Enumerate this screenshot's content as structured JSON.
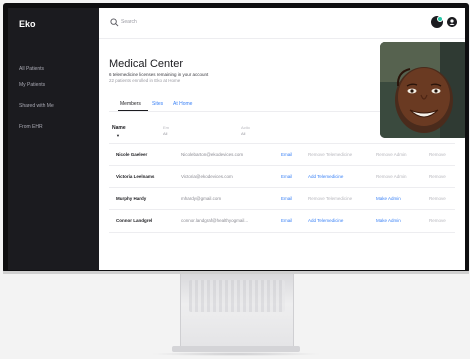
{
  "app": {
    "logo": "Eko"
  },
  "sidebar": {
    "items": [
      {
        "label": "All Patients"
      },
      {
        "label": "My Patients"
      },
      {
        "label": "Shared with Me"
      },
      {
        "label": "From EHR"
      }
    ]
  },
  "search": {
    "placeholder": "Search"
  },
  "page": {
    "title": "Medical Center",
    "subtitle": "6 telemedicine licenses remaining in your account",
    "note": "22 patients enrolled in Eko at Home"
  },
  "tabs": [
    {
      "label": "Members",
      "active": true
    },
    {
      "label": "Sites",
      "active": false
    },
    {
      "label": "At Home",
      "active": false
    }
  ],
  "table": {
    "headers": {
      "name": "Name",
      "name_sort": "▼",
      "col2": "Em",
      "col2_sub": "All",
      "col3": "Actio",
      "col3_sub": "All"
    },
    "rows": [
      {
        "name": "Nicole Gaeleer",
        "email": "Nicolebarton@ekodevices.com",
        "a1": "Email",
        "a2": "Remove Telemedicine",
        "a2_link": false,
        "a3": "Remove Admin",
        "a3_link": false,
        "a4": "Remove"
      },
      {
        "name": "Victoria Leelnams",
        "email": "Victoria@ekodevices.com",
        "a1": "Email",
        "a2": "Add Telemedicine",
        "a2_link": true,
        "a3": "Remove Admin",
        "a3_link": false,
        "a4": "Remove"
      },
      {
        "name": "Murphy Hardy",
        "email": "mhardy@gmail.com",
        "a1": "Email",
        "a2": "Remove Telemedicine",
        "a2_link": false,
        "a3": "Make Admin",
        "a3_link": true,
        "a4": "Remove"
      },
      {
        "name": "Connor Landgrel",
        "email": "connor.landgraf@healthyogmail...",
        "a1": "Email",
        "a2": "Add Telemedicine",
        "a2_link": true,
        "a3": "Make Admin",
        "a3_link": true,
        "a4": "Remove"
      }
    ]
  },
  "colors": {
    "accent": "#3b82f6",
    "sidebar_bg": "#1b1b1f",
    "status": "#2bc7a8"
  },
  "icons": {
    "search": "search-icon",
    "status": "status-icon",
    "profile": "profile-icon"
  }
}
